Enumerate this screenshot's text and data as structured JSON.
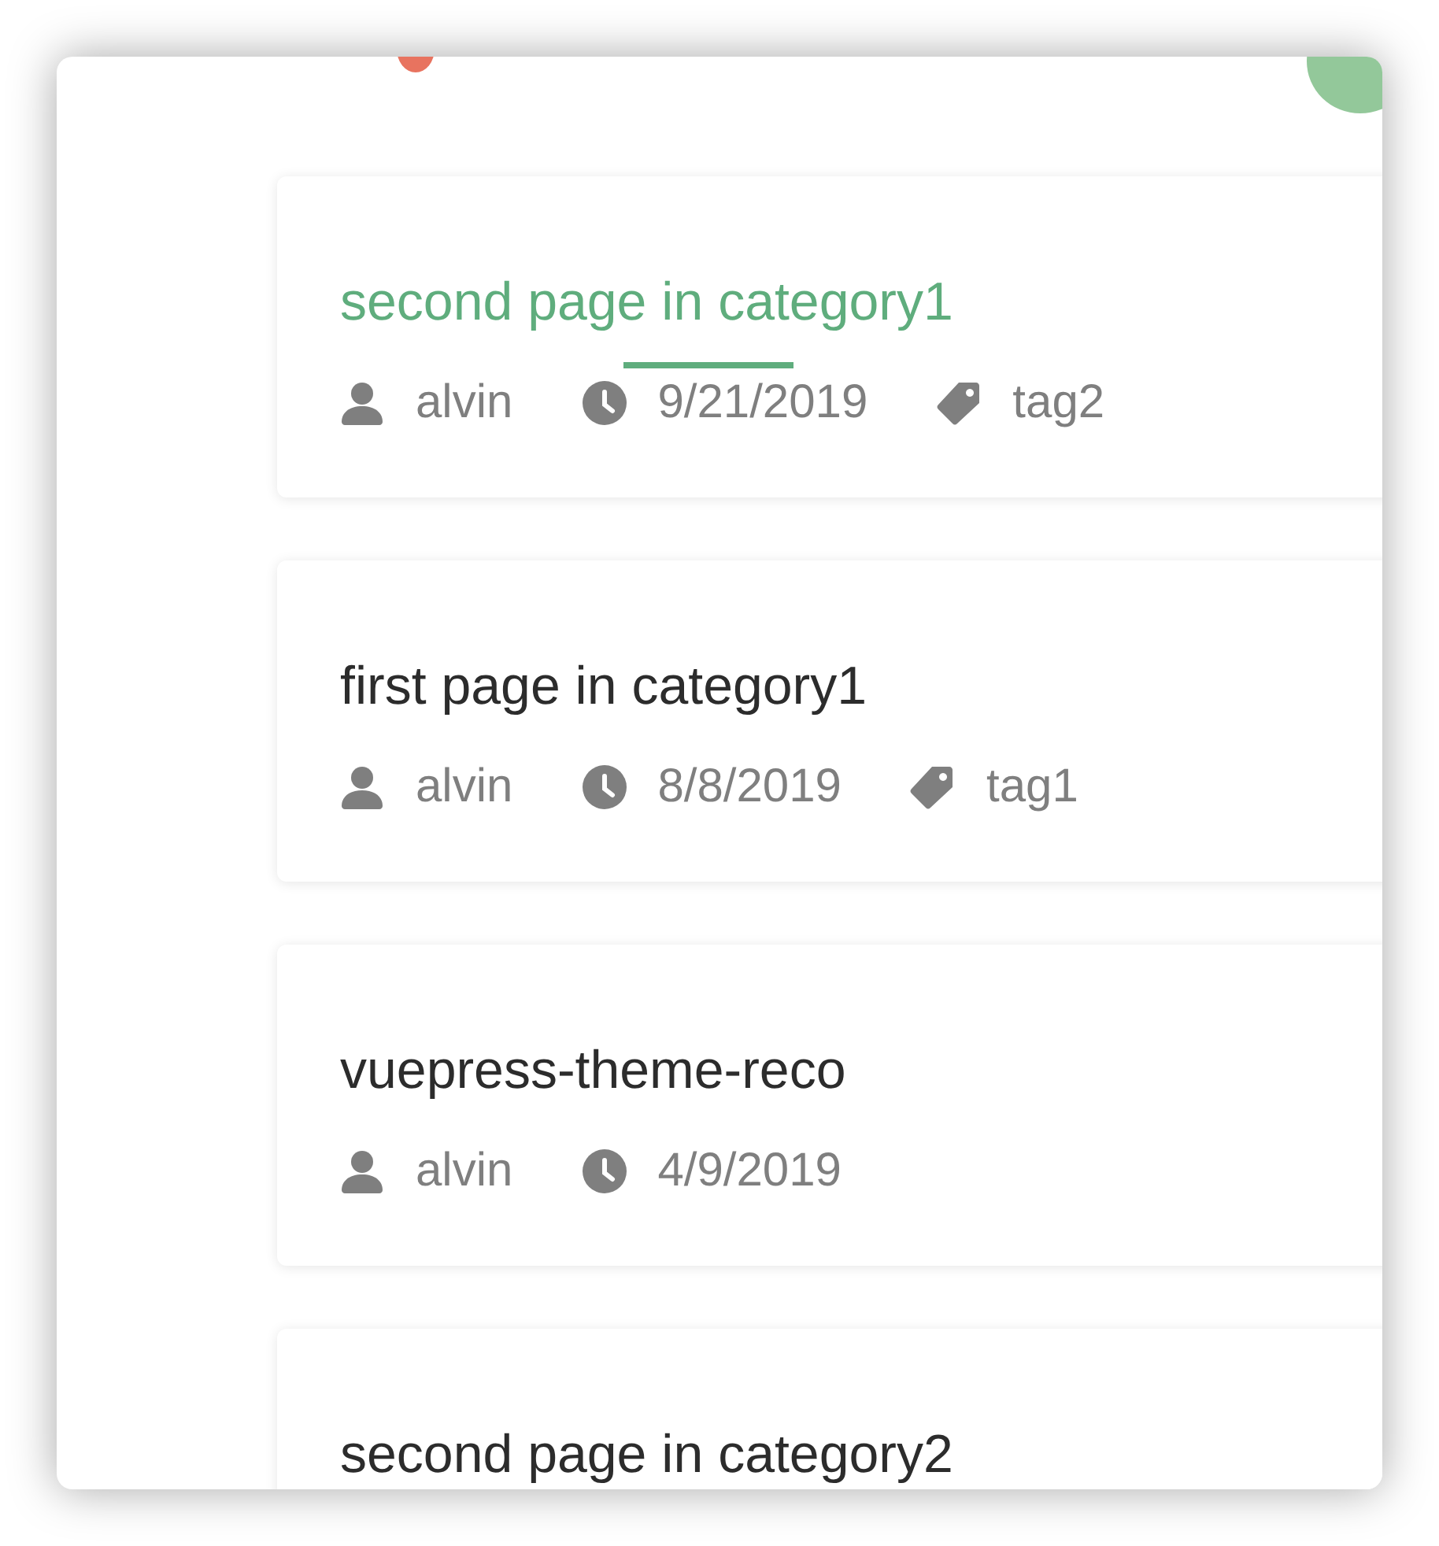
{
  "posts": [
    {
      "title": "second page in category1",
      "hovered": true,
      "author": "alvin",
      "date": "9/21/2019",
      "tag": "tag2"
    },
    {
      "title": "first page in category1",
      "hovered": false,
      "author": "alvin",
      "date": "8/8/2019",
      "tag": "tag1"
    },
    {
      "title": "vuepress-theme-reco",
      "hovered": false,
      "author": "alvin",
      "date": "4/9/2019"
    },
    {
      "title": "second page in category2",
      "hovered": false
    }
  ]
}
